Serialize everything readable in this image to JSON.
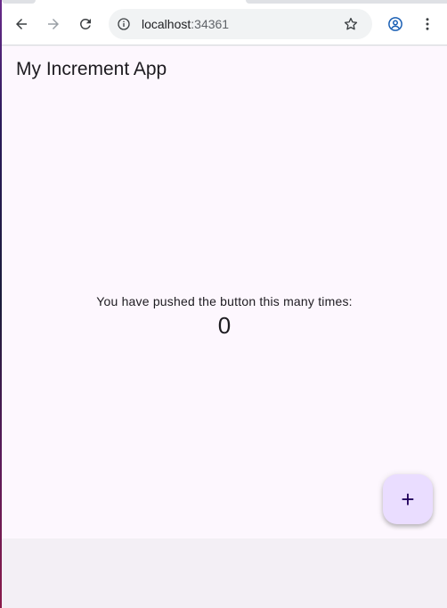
{
  "browser": {
    "url_host": "localhost",
    "url_port": ":34361",
    "icons": {
      "back": "arrow-left",
      "forward": "arrow-right",
      "reload": "reload",
      "info": "info-circle",
      "bookmark": "star-outline",
      "profile": "account-circle",
      "menu": "vertical-dots"
    }
  },
  "app": {
    "title": "My Increment App",
    "counter_label": "You have pushed the button this many times:",
    "counter_value": "0",
    "fab_glyph": "+"
  },
  "colors": {
    "app_background": "#fdf7fe",
    "fab_background": "#eaddff",
    "text": "#1d1b20"
  }
}
